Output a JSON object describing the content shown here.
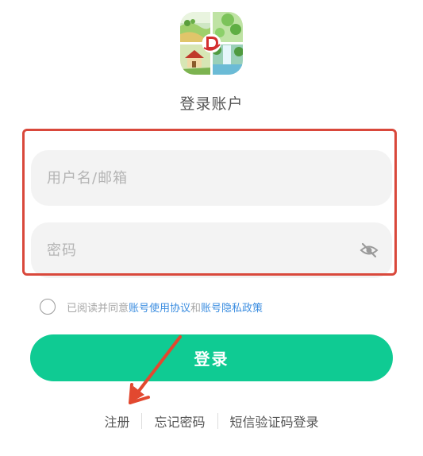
{
  "app": {
    "icon_name": "app-logo-farm-icon"
  },
  "page_title": "登录账户",
  "username": {
    "placeholder": "用户名/邮箱",
    "value": ""
  },
  "password": {
    "placeholder": "密码",
    "value": "",
    "toggle_icon": "eye-off-icon"
  },
  "agreement": {
    "prefix": "已阅读并同意",
    "link1": "账号使用协议",
    "and": "和",
    "link2": "账号隐私政策",
    "checked": false
  },
  "login_button": "登录",
  "bottom_links": {
    "register": "注册",
    "forgot_password": "忘记密码",
    "sms_login": "短信验证码登录"
  },
  "colors": {
    "accent": "#0fcb93",
    "link": "#3b8de0",
    "annotation": "#d9483b"
  }
}
